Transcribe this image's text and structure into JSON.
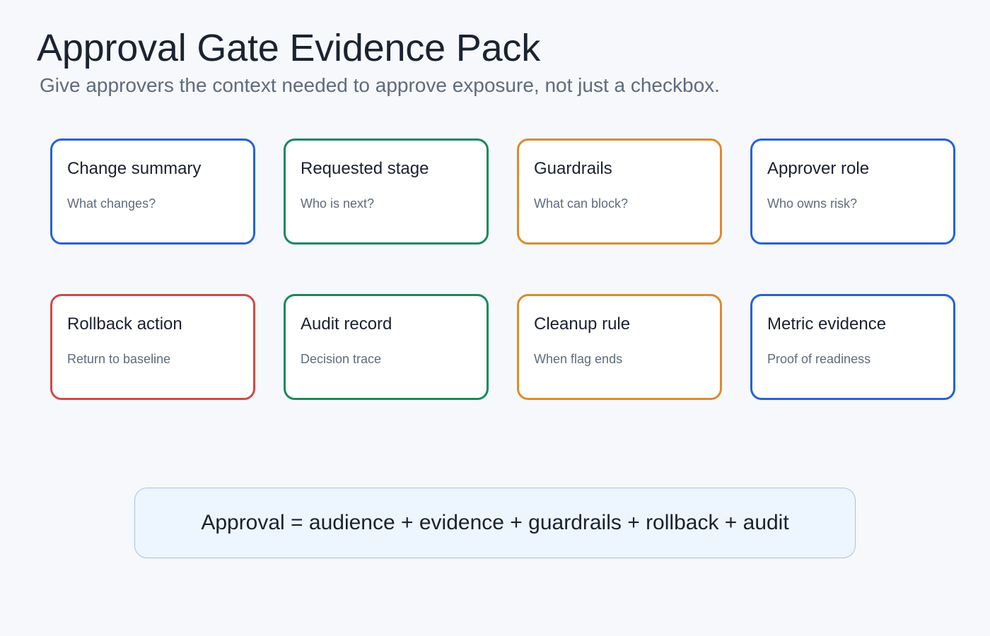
{
  "header": {
    "title": "Approval Gate Evidence Pack",
    "subtitle": "Give approvers the context needed to approve exposure, not just a checkbox."
  },
  "colors": {
    "blue": "#2463d6",
    "green": "#178a5b",
    "orange": "#de8a2f",
    "red": "#cf4a44"
  },
  "cards": [
    {
      "title": "Change summary",
      "subtitle": "What changes?",
      "color": "#2463d6"
    },
    {
      "title": "Requested stage",
      "subtitle": "Who is next?",
      "color": "#178a5b"
    },
    {
      "title": "Guardrails",
      "subtitle": "What can block?",
      "color": "#de8a2f"
    },
    {
      "title": "Approver role",
      "subtitle": "Who owns risk?",
      "color": "#2463d6"
    },
    {
      "title": "Rollback action",
      "subtitle": "Return to baseline",
      "color": "#cf4a44"
    },
    {
      "title": "Audit record",
      "subtitle": "Decision trace",
      "color": "#178a5b"
    },
    {
      "title": "Cleanup rule",
      "subtitle": "When flag ends",
      "color": "#de8a2f"
    },
    {
      "title": "Metric evidence",
      "subtitle": "Proof of readiness",
      "color": "#2463d6"
    }
  ],
  "formula": {
    "text": "Approval = audience + evidence + guardrails + rollback + audit"
  }
}
